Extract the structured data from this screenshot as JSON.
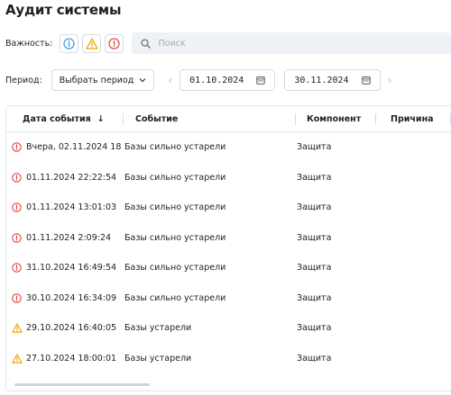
{
  "page": {
    "title": "Аудит системы"
  },
  "filters": {
    "severity_label": "Важность:",
    "search_placeholder": "Поиск",
    "period_label": "Период:",
    "period_dropdown": "Выбрать период",
    "date_from": "01.10.2024",
    "date_to": "30.11.2024"
  },
  "table": {
    "columns": [
      "Дата события",
      "Событие",
      "Компонент",
      "Причина"
    ],
    "rows": [
      {
        "severity": "error",
        "date": "Вчера, 02.11.2024 18",
        "event": "Базы сильно устарели",
        "component": "Защита",
        "reason": ""
      },
      {
        "severity": "error",
        "date": "01.11.2024 22:22:54",
        "event": "Базы сильно устарели",
        "component": "Защита",
        "reason": ""
      },
      {
        "severity": "error",
        "date": "01.11.2024 13:01:03",
        "event": "Базы сильно устарели",
        "component": "Защита",
        "reason": ""
      },
      {
        "severity": "error",
        "date": "01.11.2024 2:09:24",
        "event": "Базы сильно устарели",
        "component": "Защита",
        "reason": ""
      },
      {
        "severity": "error",
        "date": "31.10.2024 16:49:54",
        "event": "Базы сильно устарели",
        "component": "Защита",
        "reason": ""
      },
      {
        "severity": "error",
        "date": "30.10.2024 16:34:09",
        "event": "Базы сильно устарели",
        "component": "Защита",
        "reason": ""
      },
      {
        "severity": "warning",
        "date": "29.10.2024 16:40:05",
        "event": "Базы устарели",
        "component": "Защита",
        "reason": ""
      },
      {
        "severity": "warning",
        "date": "27.10.2024 18:00:01",
        "event": "Базы устарели",
        "component": "Защита",
        "reason": ""
      }
    ]
  },
  "colors": {
    "info": "#3b9be0",
    "warning": "#f0a800",
    "error": "#e0453a"
  }
}
